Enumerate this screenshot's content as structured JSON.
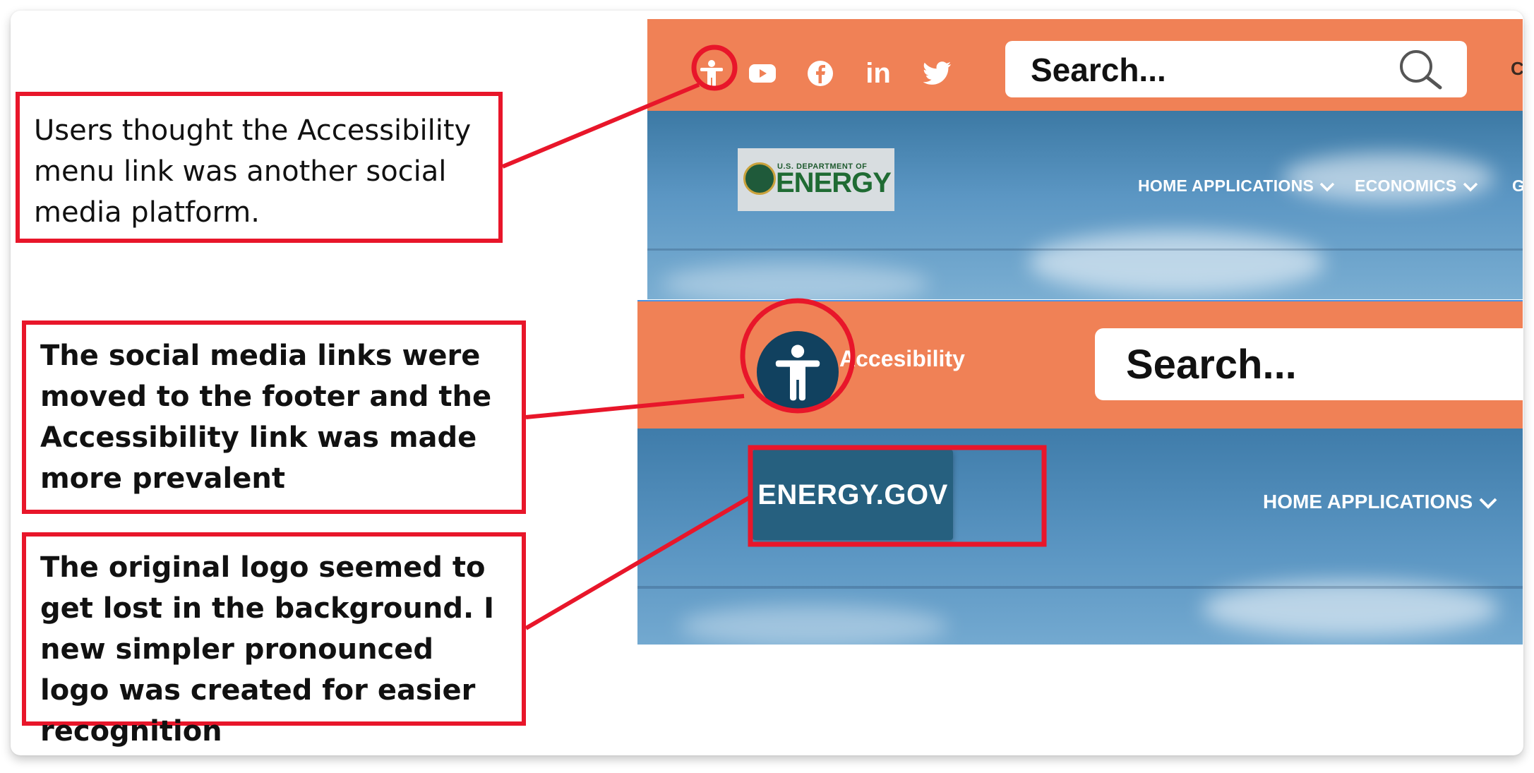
{
  "callouts": {
    "one": "Users thought the Accessibility menu link was another social media platform.",
    "two": "The social media links were moved to the footer and the Accessibility link was made more prevalent",
    "three": "The original logo seemed to get lost in the background. I new simpler pronounced logo was created for easier recognition"
  },
  "original_header": {
    "social_icons": [
      "accessibility-icon",
      "youtube-icon",
      "facebook-icon",
      "linkedin-icon",
      "twitter-icon"
    ],
    "linkedin_text": "in",
    "search_placeholder": "Search...",
    "cutoff_text": "Co",
    "logo_small": "U.S. DEPARTMENT OF",
    "logo_big": "ENERGY",
    "nav": [
      "HOME APPLICATIONS",
      "ECONOMICS",
      "G"
    ]
  },
  "new_header": {
    "accessibility_label": "Accesibility",
    "search_placeholder": "Search...",
    "logo_text": "ENERGY.GOV",
    "nav": [
      "HOME APPLICATIONS"
    ]
  },
  "colors": {
    "header_orange": "#f08156",
    "annotation_red": "#e8162a",
    "accessibility_navy": "#11415f",
    "logo_blue": "#26607f"
  }
}
